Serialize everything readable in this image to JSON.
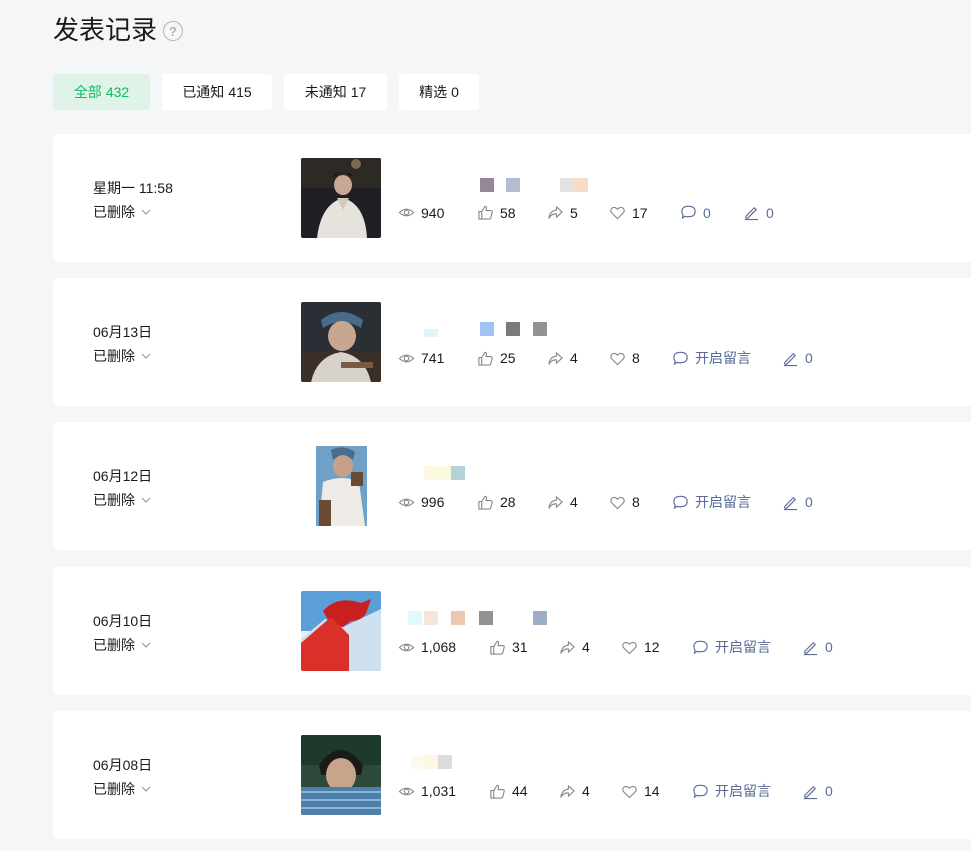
{
  "page_title": "发表记录",
  "filters": [
    {
      "label": "全部",
      "count": "432"
    },
    {
      "label": "已通知",
      "count": "415"
    },
    {
      "label": "未通知",
      "count": "17"
    },
    {
      "label": "精选",
      "count": "0"
    }
  ],
  "posts": [
    {
      "date": "星期一 11:58",
      "status": "已删除",
      "views": "940",
      "likes": "58",
      "shares": "5",
      "favs": "17",
      "comments": "0",
      "edits": "0"
    },
    {
      "date": "06月13日",
      "status": "已删除",
      "views": "741",
      "likes": "25",
      "shares": "4",
      "favs": "8",
      "comments": "开启留言",
      "edits": "0"
    },
    {
      "date": "06月12日",
      "status": "已删除",
      "views": "996",
      "likes": "28",
      "shares": "4",
      "favs": "8",
      "comments": "开启留言",
      "edits": "0"
    },
    {
      "date": "06月10日",
      "status": "已删除",
      "views": "1,068",
      "likes": "31",
      "shares": "4",
      "favs": "12",
      "comments": "开启留言",
      "edits": "0"
    },
    {
      "date": "06月08日",
      "status": "已删除",
      "views": "1,031",
      "likes": "44",
      "shares": "4",
      "favs": "14",
      "comments": "开启留言",
      "edits": "0"
    }
  ],
  "colors": {
    "accent": "#07c160",
    "link": "#576b95"
  }
}
